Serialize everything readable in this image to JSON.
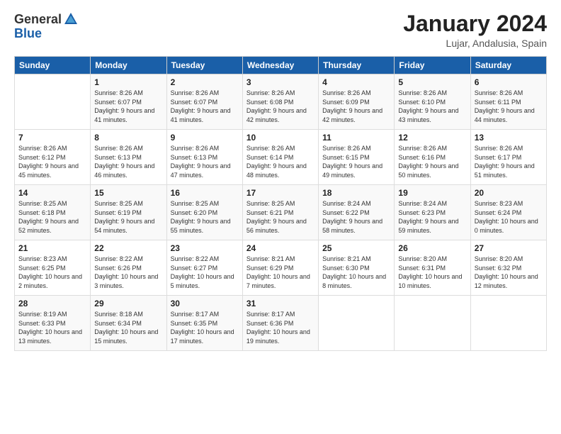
{
  "header": {
    "logo_general": "General",
    "logo_blue": "Blue",
    "month_title": "January 2024",
    "location": "Lujar, Andalusia, Spain"
  },
  "days_of_week": [
    "Sunday",
    "Monday",
    "Tuesday",
    "Wednesday",
    "Thursday",
    "Friday",
    "Saturday"
  ],
  "weeks": [
    [
      {
        "day": "",
        "sunrise": "",
        "sunset": "",
        "daylight": ""
      },
      {
        "day": "1",
        "sunrise": "Sunrise: 8:26 AM",
        "sunset": "Sunset: 6:07 PM",
        "daylight": "Daylight: 9 hours and 41 minutes."
      },
      {
        "day": "2",
        "sunrise": "Sunrise: 8:26 AM",
        "sunset": "Sunset: 6:07 PM",
        "daylight": "Daylight: 9 hours and 41 minutes."
      },
      {
        "day": "3",
        "sunrise": "Sunrise: 8:26 AM",
        "sunset": "Sunset: 6:08 PM",
        "daylight": "Daylight: 9 hours and 42 minutes."
      },
      {
        "day": "4",
        "sunrise": "Sunrise: 8:26 AM",
        "sunset": "Sunset: 6:09 PM",
        "daylight": "Daylight: 9 hours and 42 minutes."
      },
      {
        "day": "5",
        "sunrise": "Sunrise: 8:26 AM",
        "sunset": "Sunset: 6:10 PM",
        "daylight": "Daylight: 9 hours and 43 minutes."
      },
      {
        "day": "6",
        "sunrise": "Sunrise: 8:26 AM",
        "sunset": "Sunset: 6:11 PM",
        "daylight": "Daylight: 9 hours and 44 minutes."
      }
    ],
    [
      {
        "day": "7",
        "sunrise": "Sunrise: 8:26 AM",
        "sunset": "Sunset: 6:12 PM",
        "daylight": "Daylight: 9 hours and 45 minutes."
      },
      {
        "day": "8",
        "sunrise": "Sunrise: 8:26 AM",
        "sunset": "Sunset: 6:13 PM",
        "daylight": "Daylight: 9 hours and 46 minutes."
      },
      {
        "day": "9",
        "sunrise": "Sunrise: 8:26 AM",
        "sunset": "Sunset: 6:13 PM",
        "daylight": "Daylight: 9 hours and 47 minutes."
      },
      {
        "day": "10",
        "sunrise": "Sunrise: 8:26 AM",
        "sunset": "Sunset: 6:14 PM",
        "daylight": "Daylight: 9 hours and 48 minutes."
      },
      {
        "day": "11",
        "sunrise": "Sunrise: 8:26 AM",
        "sunset": "Sunset: 6:15 PM",
        "daylight": "Daylight: 9 hours and 49 minutes."
      },
      {
        "day": "12",
        "sunrise": "Sunrise: 8:26 AM",
        "sunset": "Sunset: 6:16 PM",
        "daylight": "Daylight: 9 hours and 50 minutes."
      },
      {
        "day": "13",
        "sunrise": "Sunrise: 8:26 AM",
        "sunset": "Sunset: 6:17 PM",
        "daylight": "Daylight: 9 hours and 51 minutes."
      }
    ],
    [
      {
        "day": "14",
        "sunrise": "Sunrise: 8:25 AM",
        "sunset": "Sunset: 6:18 PM",
        "daylight": "Daylight: 9 hours and 52 minutes."
      },
      {
        "day": "15",
        "sunrise": "Sunrise: 8:25 AM",
        "sunset": "Sunset: 6:19 PM",
        "daylight": "Daylight: 9 hours and 54 minutes."
      },
      {
        "day": "16",
        "sunrise": "Sunrise: 8:25 AM",
        "sunset": "Sunset: 6:20 PM",
        "daylight": "Daylight: 9 hours and 55 minutes."
      },
      {
        "day": "17",
        "sunrise": "Sunrise: 8:25 AM",
        "sunset": "Sunset: 6:21 PM",
        "daylight": "Daylight: 9 hours and 56 minutes."
      },
      {
        "day": "18",
        "sunrise": "Sunrise: 8:24 AM",
        "sunset": "Sunset: 6:22 PM",
        "daylight": "Daylight: 9 hours and 58 minutes."
      },
      {
        "day": "19",
        "sunrise": "Sunrise: 8:24 AM",
        "sunset": "Sunset: 6:23 PM",
        "daylight": "Daylight: 9 hours and 59 minutes."
      },
      {
        "day": "20",
        "sunrise": "Sunrise: 8:23 AM",
        "sunset": "Sunset: 6:24 PM",
        "daylight": "Daylight: 10 hours and 0 minutes."
      }
    ],
    [
      {
        "day": "21",
        "sunrise": "Sunrise: 8:23 AM",
        "sunset": "Sunset: 6:25 PM",
        "daylight": "Daylight: 10 hours and 2 minutes."
      },
      {
        "day": "22",
        "sunrise": "Sunrise: 8:22 AM",
        "sunset": "Sunset: 6:26 PM",
        "daylight": "Daylight: 10 hours and 3 minutes."
      },
      {
        "day": "23",
        "sunrise": "Sunrise: 8:22 AM",
        "sunset": "Sunset: 6:27 PM",
        "daylight": "Daylight: 10 hours and 5 minutes."
      },
      {
        "day": "24",
        "sunrise": "Sunrise: 8:21 AM",
        "sunset": "Sunset: 6:29 PM",
        "daylight": "Daylight: 10 hours and 7 minutes."
      },
      {
        "day": "25",
        "sunrise": "Sunrise: 8:21 AM",
        "sunset": "Sunset: 6:30 PM",
        "daylight": "Daylight: 10 hours and 8 minutes."
      },
      {
        "day": "26",
        "sunrise": "Sunrise: 8:20 AM",
        "sunset": "Sunset: 6:31 PM",
        "daylight": "Daylight: 10 hours and 10 minutes."
      },
      {
        "day": "27",
        "sunrise": "Sunrise: 8:20 AM",
        "sunset": "Sunset: 6:32 PM",
        "daylight": "Daylight: 10 hours and 12 minutes."
      }
    ],
    [
      {
        "day": "28",
        "sunrise": "Sunrise: 8:19 AM",
        "sunset": "Sunset: 6:33 PM",
        "daylight": "Daylight: 10 hours and 13 minutes."
      },
      {
        "day": "29",
        "sunrise": "Sunrise: 8:18 AM",
        "sunset": "Sunset: 6:34 PM",
        "daylight": "Daylight: 10 hours and 15 minutes."
      },
      {
        "day": "30",
        "sunrise": "Sunrise: 8:17 AM",
        "sunset": "Sunset: 6:35 PM",
        "daylight": "Daylight: 10 hours and 17 minutes."
      },
      {
        "day": "31",
        "sunrise": "Sunrise: 8:17 AM",
        "sunset": "Sunset: 6:36 PM",
        "daylight": "Daylight: 10 hours and 19 minutes."
      },
      {
        "day": "",
        "sunrise": "",
        "sunset": "",
        "daylight": ""
      },
      {
        "day": "",
        "sunrise": "",
        "sunset": "",
        "daylight": ""
      },
      {
        "day": "",
        "sunrise": "",
        "sunset": "",
        "daylight": ""
      }
    ]
  ]
}
